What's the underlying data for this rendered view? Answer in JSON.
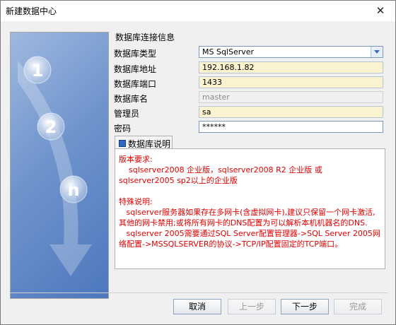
{
  "window": {
    "title": "新建数据中心",
    "close_label": "✕"
  },
  "section_title": "数据库连接信息",
  "form": {
    "db_type_label": "数据库类型",
    "db_type_value": "MS SqlServer",
    "db_address_label": "数据库地址",
    "db_address_value": "192.168.1.82",
    "db_port_label": "数据库端口",
    "db_port_value": "1433",
    "db_name_label": "数据库名",
    "db_name_value": "master",
    "admin_label": "管理员",
    "admin_value": "sa",
    "password_label": "密码",
    "password_value": "******"
  },
  "description": {
    "tab_label": "数据库说明",
    "text": "版本要求:\n    sqlserver2008 企业版，sqlserver2008 R2 企业版 或\nsqlserver2005 sp2以上的企业版\n\n特殊说明:\n   sqlserver服务器如果存在多网卡(含虚拟网卡),建议只保留一个网卡激活,其他的网卡禁用;或将所有网卡的DNS配置为可以解析本机机器名的DNS.\n   sqlserver 2005需要通过SQL Server配置管理器->SQL Server 2005网络配置->MSSQLSERVER的协议->TCP/IP配置固定的TCP端口。"
  },
  "wizard_steps": [
    "1",
    "2",
    "n"
  ],
  "buttons": {
    "cancel": "取消",
    "prev": "上一步",
    "next": "下一步",
    "finish": "完成"
  },
  "colors": {
    "description_text": "#e00000",
    "field_highlight": "#fbf3cf",
    "panel_blue": "#4d78be"
  }
}
